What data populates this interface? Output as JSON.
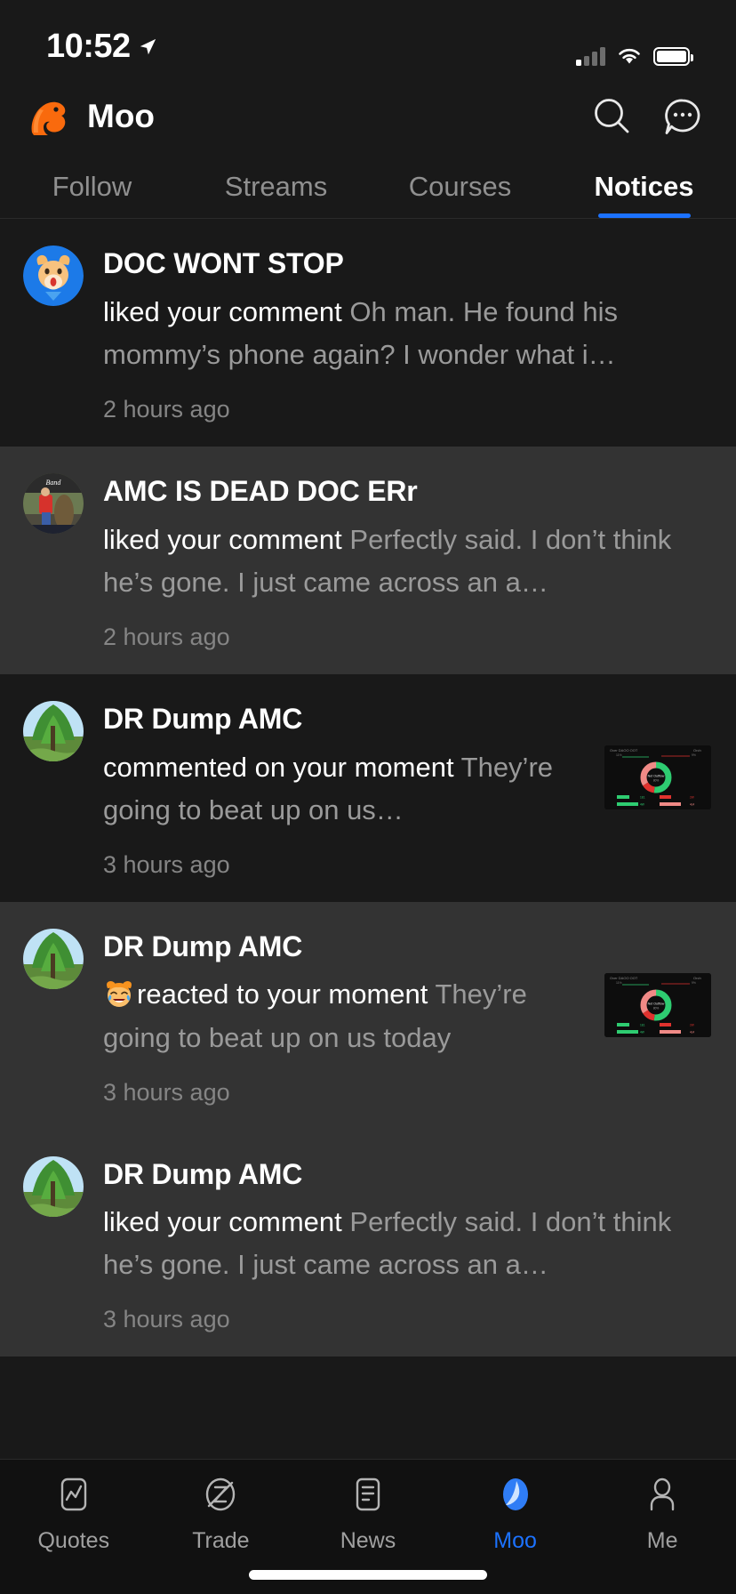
{
  "status_bar": {
    "time": "10:52",
    "location_icon": "location-arrow-icon",
    "signal_icon": "cellular-signal-icon",
    "wifi_icon": "wifi-icon",
    "battery_icon": "battery-full-icon"
  },
  "header": {
    "logo_icon": "moo-bull-logo-icon",
    "title": "Moo",
    "search_icon": "search-icon",
    "more_icon": "more-chat-icon"
  },
  "tabs": {
    "items": [
      {
        "label": "Follow",
        "active": false
      },
      {
        "label": "Streams",
        "active": false
      },
      {
        "label": "Courses",
        "active": false
      },
      {
        "label": "Notices",
        "active": true
      }
    ],
    "active_indicator_color": "#1c72ff"
  },
  "notifications": [
    {
      "user": "DOC WONT STOP",
      "avatar": "cow-face-avatar",
      "action": "liked your comment",
      "quote": "Oh man. He found his mommy’s phone again? I wonder what i…",
      "time": "2 hours ago",
      "has_thumbnail": false,
      "has_reaction_emoji": false,
      "row_style": "dark"
    },
    {
      "user": "AMC IS DEAD DOC ERr",
      "avatar": "person-photo-avatar",
      "action": "liked your comment",
      "quote": "Perfectly said. I don’t think he’s gone. I just came across an a…",
      "time": "2 hours ago",
      "has_thumbnail": false,
      "has_reaction_emoji": false,
      "row_style": "alt"
    },
    {
      "user": "DR Dump AMC",
      "avatar": "tree-photo-avatar",
      "action": "commented on your moment",
      "quote": "They’re going to beat up on us…",
      "time": "3 hours ago",
      "has_thumbnail": true,
      "has_reaction_emoji": false,
      "row_style": "dark"
    },
    {
      "user": "DR Dump AMC",
      "avatar": "tree-photo-avatar",
      "action": "reacted to your moment",
      "quote": "They’re going to beat up on us today",
      "time": "3 hours ago",
      "has_thumbnail": true,
      "has_reaction_emoji": true,
      "reaction_emoji": "laughing-bull-emoji",
      "row_style": "alt"
    },
    {
      "user": "DR Dump AMC",
      "avatar": "tree-photo-avatar",
      "action": "liked your comment",
      "quote": "Perfectly said. I don’t think he’s gone. I just came across an a…",
      "time": "3 hours ago",
      "has_thumbnail": false,
      "has_reaction_emoji": false,
      "row_style": "alt"
    }
  ],
  "thumbnail_chart": {
    "type": "pie",
    "title": "Over  DAOO  OOT",
    "corner_label": "Orch",
    "center_label": "Net Outflow",
    "center_value": "80%",
    "slices": [
      {
        "label": "green-inflow",
        "value": 52,
        "color": "#2ecc71"
      },
      {
        "label": "red-outflow-dark",
        "value": 14,
        "color": "#e0322e"
      },
      {
        "label": "red-outflow-light",
        "value": 34,
        "color": "#f08a86"
      }
    ],
    "bars": [
      {
        "left_value": 32,
        "left_color": "#2ecc71",
        "right_value": 38,
        "right_color": "#e0322e"
      },
      {
        "left_value": 62,
        "left_color": "#2ecc71",
        "right_value": 66,
        "right_color": "#f08a86"
      }
    ]
  },
  "bottom_nav": {
    "items": [
      {
        "label": "Quotes",
        "icon": "quotes-chart-icon",
        "active": false
      },
      {
        "label": "Trade",
        "icon": "trade-z-icon",
        "active": false
      },
      {
        "label": "News",
        "icon": "news-document-icon",
        "active": false
      },
      {
        "label": "Moo",
        "icon": "moo-leaf-icon",
        "active": true
      },
      {
        "label": "Me",
        "icon": "person-profile-icon",
        "active": false
      }
    ],
    "active_color": "#1c72ff"
  },
  "home_indicator": "home-indicator-bar"
}
